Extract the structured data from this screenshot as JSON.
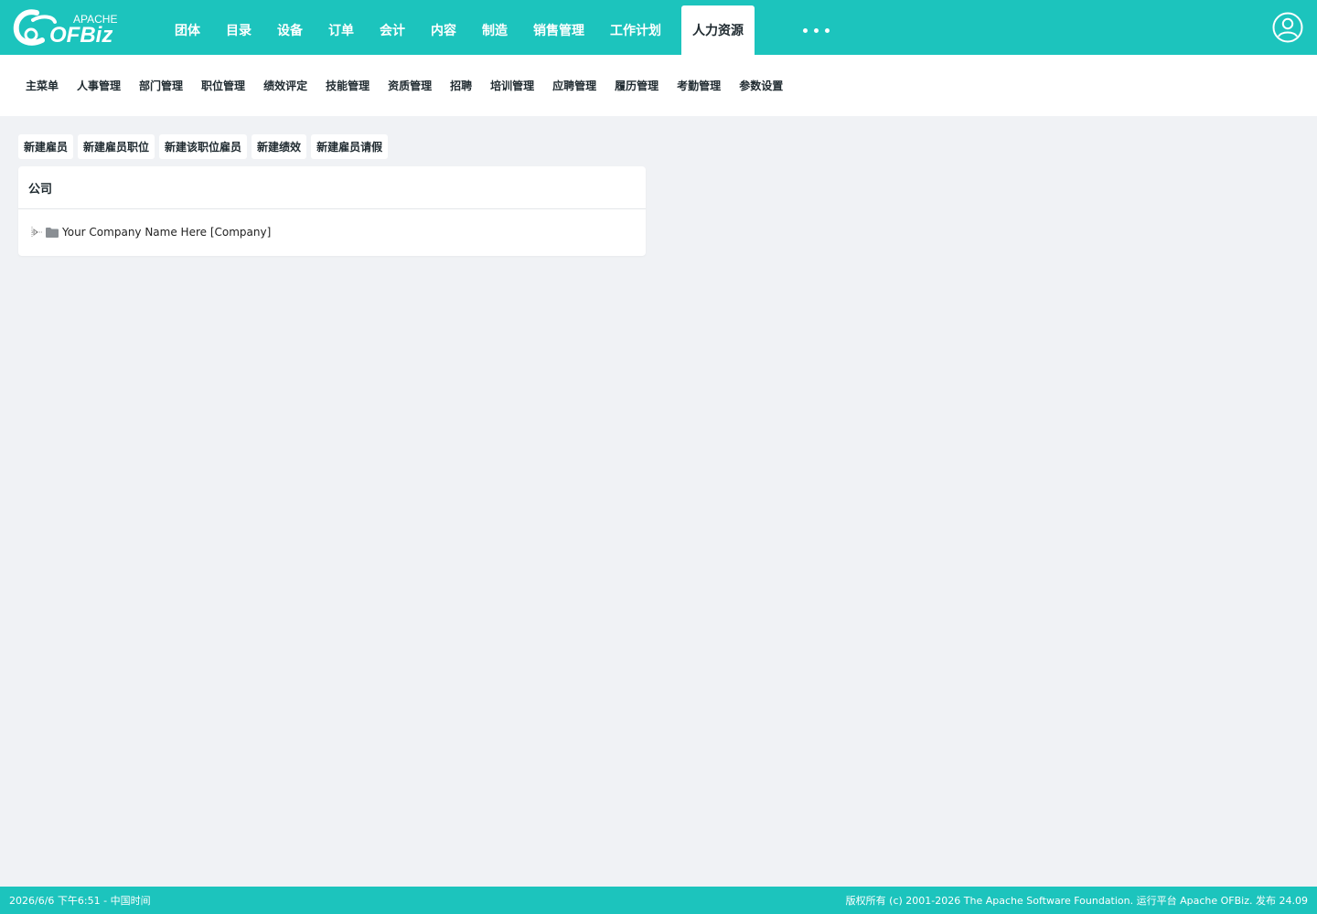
{
  "logo": {
    "text_top": "APACHE",
    "text_main": "OFBiz"
  },
  "main_nav": {
    "items": [
      "团体",
      "目录",
      "设备",
      "订单",
      "会计",
      "内容",
      "制造",
      "销售管理",
      "工作计划"
    ],
    "active": "人力资源"
  },
  "more_menu_icon": "ellipsis-icon",
  "user_icon": "user-circle-icon",
  "sub_nav": {
    "items": [
      "主菜单",
      "人事管理",
      "部门管理",
      "职位管理",
      "绩效评定",
      "技能管理",
      "资质管理",
      "招聘",
      "培训管理",
      "应聘管理",
      "履历管理",
      "考勤管理",
      "参数设置"
    ]
  },
  "actions": [
    "新建雇员",
    "新建雇员职位",
    "新建该职位雇员",
    "新建绩效",
    "新建雇员请假"
  ],
  "panel": {
    "title": "公司",
    "tree": {
      "label": "Your Company Name Here [Company]",
      "icon": "folder-icon"
    }
  },
  "footer": {
    "left": "2026/6/6 下午6:51 - 中国时间",
    "right": "版权所有 (c) 2001-2026 The Apache Software Foundation. 运行平台 Apache OFBiz. 发布 24.09"
  },
  "colors": {
    "brand": "#1cc4bd",
    "background": "#f0f2f5",
    "text": "#1f2a30"
  }
}
